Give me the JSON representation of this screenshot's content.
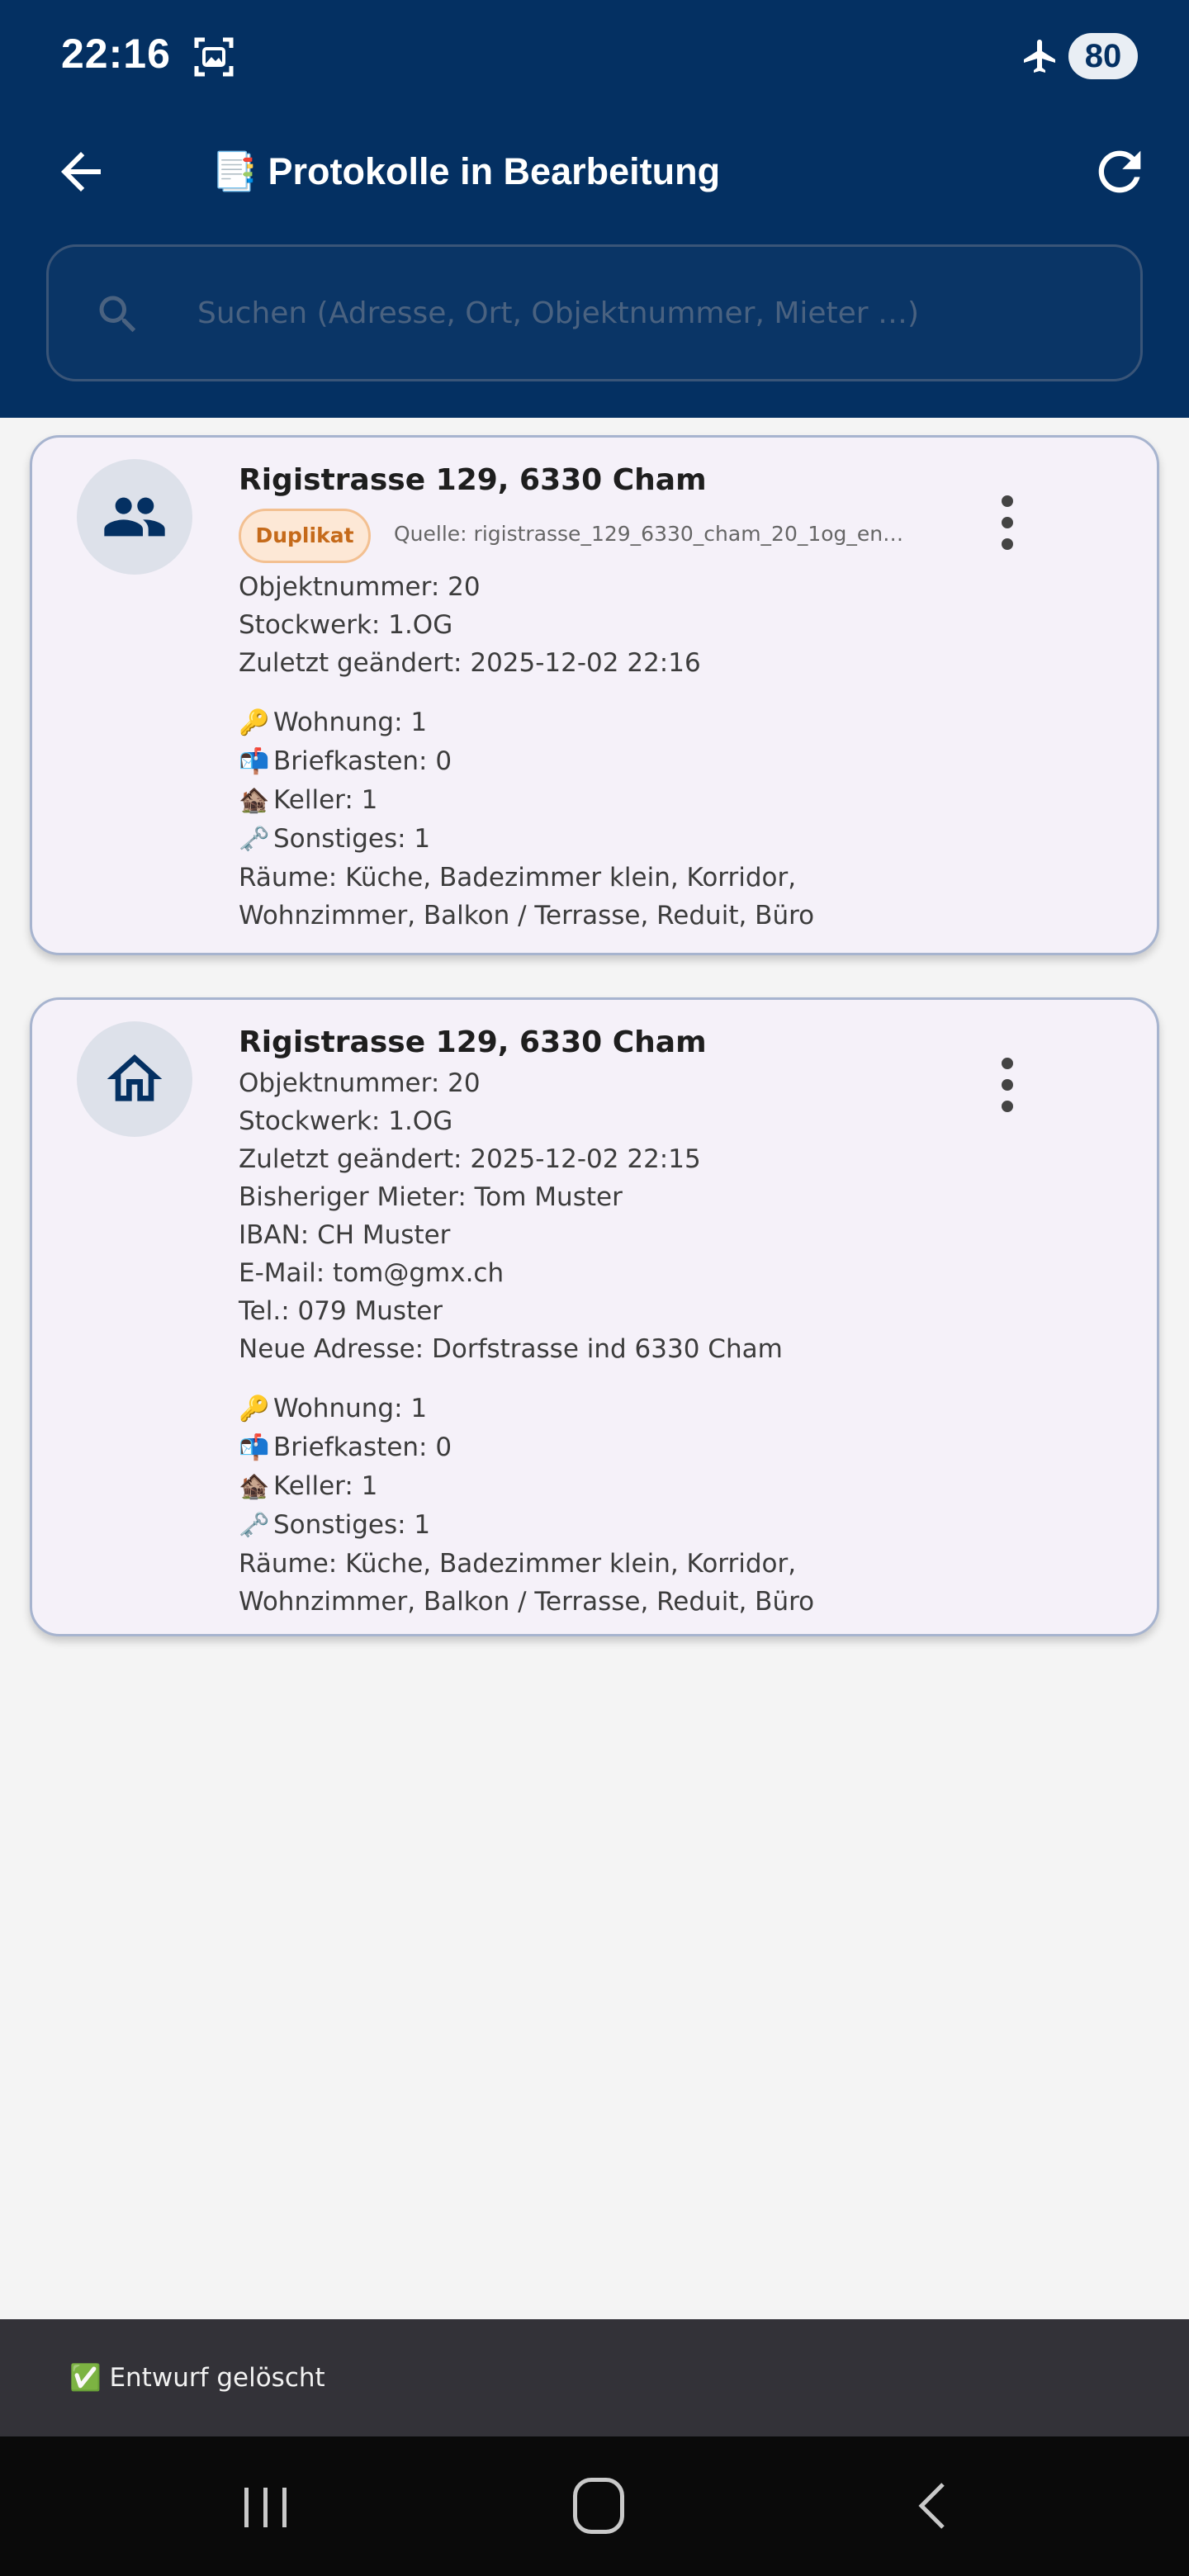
{
  "status_bar": {
    "time": "22:16",
    "battery": "80",
    "icons": [
      "screenshot-icon",
      "airplane-mode-icon"
    ]
  },
  "app_bar": {
    "title": "📑 Protokolle in Bearbeitung",
    "icons": [
      "back-arrow-icon",
      "refresh-icon"
    ]
  },
  "search": {
    "placeholder": "Suchen (Adresse, Ort, Objektnummer, Mieter …)",
    "icon": "search-icon"
  },
  "cards": [
    {
      "avatar_icon": "people-icon",
      "title": "Rigistrasse 129, 6330 Cham",
      "badge": "Duplikat",
      "source": "Quelle: rigistrasse_129_6330_cham_20_1og_entw…",
      "details": [
        "Objektnummer: 20",
        "Stockwerk: 1.OG",
        "Zuletzt geändert: 2025-12-02 22:16"
      ],
      "keys": [
        {
          "emoji": "🔑",
          "text": "Wohnung: 1"
        },
        {
          "emoji": "📬",
          "text": "Briefkasten: 0"
        },
        {
          "emoji": "🏚️",
          "text": "Keller: 1"
        },
        {
          "emoji": "🗝️",
          "text": "Sonstiges: 1"
        }
      ],
      "rooms": "Räume: Küche, Badezimmer klein, Korridor, Wohnzimmer, Balkon / Terrasse, Reduit, Büro"
    },
    {
      "avatar_icon": "home-icon",
      "title": "Rigistrasse 129, 6330 Cham",
      "details": [
        "Objektnummer: 20",
        "Stockwerk: 1.OG",
        "Zuletzt geändert: 2025-12-02 22:15",
        "Bisheriger Mieter: Tom Muster",
        "IBAN: CH Muster",
        "E-Mail: tom@gmx.ch",
        "Tel.: 079 Muster",
        "Neue Adresse: Dorfstrasse ind 6330 Cham"
      ],
      "keys": [
        {
          "emoji": "🔑",
          "text": "Wohnung: 1"
        },
        {
          "emoji": "📬",
          "text": "Briefkasten: 0"
        },
        {
          "emoji": "🏚️",
          "text": "Keller: 1"
        },
        {
          "emoji": "🗝️",
          "text": "Sonstiges: 1"
        }
      ],
      "rooms": "Räume: Küche, Badezimmer klein, Korridor, Wohnzimmer, Balkon / Terrasse, Reduit, Büro"
    }
  ],
  "snackbar": {
    "text": "✅ Entwurf gelöscht"
  },
  "colors": {
    "primary": "#043062",
    "card_bg": "#f5f1f9",
    "badge_bg": "#fde8d6",
    "badge_text": "#c56a1a"
  }
}
